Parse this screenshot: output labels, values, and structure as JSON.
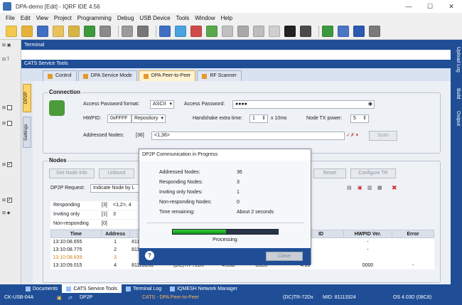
{
  "window": {
    "title": "DPA-demo [Edit] - IQRF IDE 4.56",
    "controls": [
      "—",
      "☐",
      "✕"
    ]
  },
  "menu": [
    "File",
    "Edit",
    "View",
    "Project",
    "Programming",
    "Debug",
    "USB Device",
    "Tools",
    "Window",
    "Help"
  ],
  "panels": {
    "terminal": "Terminal",
    "cats": "CATS Service Tools"
  },
  "tabs": [
    {
      "label": "Control",
      "active": false
    },
    {
      "label": "DPA Service Mode",
      "active": false
    },
    {
      "label": "DPA Peer-to-Peer",
      "active": true
    },
    {
      "label": "RF Scanner",
      "active": false
    }
  ],
  "side_tabs": [
    "DP2P",
    "Settings"
  ],
  "right_tabs": [
    "Upload Log",
    "Build",
    "Output"
  ],
  "connection": {
    "title": "Connection",
    "access_format_label": "Access Password format:",
    "access_format_value": "ASCII",
    "access_password_label": "Access Password:",
    "access_password_value": "●●●●",
    "hwpid_label": "HWPID:",
    "hwpid_value": "0xFFFF",
    "hwpid_source": "Repository",
    "handshake_label": "Handshake extra time:",
    "handshake_value": "1",
    "handshake_unit": "x 10ms",
    "tx_power_label": "Node TX power:",
    "tx_power_value": "5",
    "addressed_label": "Addressed Nodes:",
    "addressed_count": "[36]",
    "addressed_value": "<1,36>",
    "scan_button": "Scan"
  },
  "nodes": {
    "title": "Nodes",
    "buttons": [
      "Get Node Info",
      "Unbond",
      "Reset",
      "Configure TR"
    ],
    "request_label": "DP2P Request:",
    "request_value": "Indicate Node by L",
    "status_rows": [
      {
        "label": "Responding",
        "count": "[3]",
        "value": "<1,2>, 4"
      },
      {
        "label": "Inviting only",
        "count": "[1]",
        "value": "3"
      },
      {
        "label": "Non-responding",
        "count": "[0]",
        "value": ""
      }
    ],
    "columns": [
      "Time",
      "Address",
      "",
      "",
      "",
      "",
      "ID",
      "HWPID Ver.",
      "Error"
    ],
    "rows": [
      {
        "time": "13:10:08.655",
        "address": "1",
        "mid": "811",
        "tr": "",
        "os": "",
        "dpa": "",
        "id": "",
        "hwpid_ver": "-",
        "error": "",
        "orange": false
      },
      {
        "time": "13:10:08.775",
        "address": "2",
        "mid": "811",
        "tr": "",
        "os": "",
        "dpa": "",
        "id": "",
        "hwpid_ver": "-",
        "error": "",
        "orange": false
      },
      {
        "time": "13:10:08.839",
        "address": "3",
        "mid": "",
        "tr": "",
        "os": "",
        "dpa": "",
        "id": "",
        "hwpid_ver": "",
        "error": "",
        "orange": true
      },
      {
        "time": "13:10:09.015",
        "address": "4",
        "mid": "81113C62",
        "tr": "(DC)TR-72Dx",
        "os": "4.03D",
        "dpa": "08C8",
        "id": "4.10",
        "hwpid_ver": "0000",
        "error": "-",
        "orange": false
      }
    ]
  },
  "modal": {
    "title": "DP2P Communication in Progress",
    "stats": [
      {
        "label": "Addressed Nodes:",
        "value": "36"
      },
      {
        "label": "Responding Nodes:",
        "value": "3"
      },
      {
        "label": "Inviting only Nodes:",
        "value": "1"
      },
      {
        "label": "Non-responding Nodes:",
        "value": "0"
      },
      {
        "label": "Time remaining:",
        "value": "About 2 seconds"
      }
    ],
    "progress_fraction": 0.51,
    "progress_label": "Processing",
    "close_label": "Close"
  },
  "bottom_tabs": [
    {
      "label": "Documents",
      "active": false
    },
    {
      "label": "CATS Service Tools",
      "active": true
    },
    {
      "label": "Terminal Log",
      "active": false
    },
    {
      "label": "IQMESH Network Manager",
      "active": false
    }
  ],
  "status": {
    "device": "CK-USB-04A",
    "mode": "DP2P",
    "tool": "CATS - DPA Peer-to-Peer",
    "tr": "(DC)TR-72Dx",
    "mid": "MID: 81113324",
    "os": "OS 4.03D (08C8)"
  },
  "colors": {
    "accent": "#1f4e96",
    "progress": "#19b020",
    "warning": "#d4831b"
  }
}
